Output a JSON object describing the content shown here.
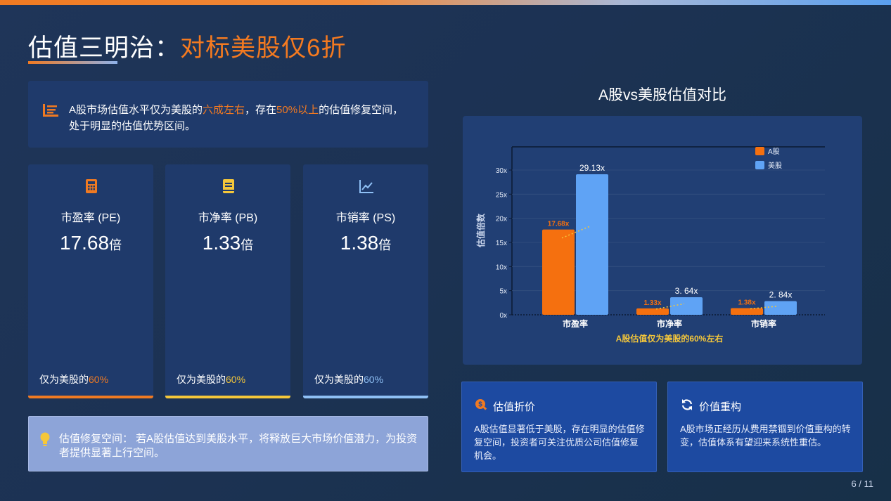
{
  "title": {
    "main": "估值三明治：",
    "accent": "对标美股仅6折"
  },
  "info": {
    "icon": "list-chart-icon",
    "part1": "A股市场估值水平仅为美股的",
    "hl1": "六成左右",
    "part2": "，存在",
    "hl2": "50%以上",
    "part3": "的估值修复空间，处于明显的估值优势区间。"
  },
  "cards": [
    {
      "icon": "calculator-icon",
      "label": "市盈率 (PE)",
      "value": "17.68",
      "unit": "倍",
      "note_prefix": "仅为美股的",
      "note_pct": "60%",
      "accent": "#f07a22"
    },
    {
      "icon": "book-icon",
      "label": "市净率 (PB)",
      "value": "1.33",
      "unit": "倍",
      "note_prefix": "仅为美股的",
      "note_pct": "60%",
      "accent": "#f5c73a"
    },
    {
      "icon": "line-chart-icon",
      "label": "市销率 (PS)",
      "value": "1.38",
      "unit": "倍",
      "note_prefix": "仅为美股的",
      "note_pct": "60%",
      "accent": "#8fc0f5"
    }
  ],
  "tip": {
    "icon": "lightbulb-icon",
    "text": "估值修复空间： 若A股估值达到美股水平，将释放巨大市场价值潜力，为投资者提供显著上行空间。"
  },
  "chart_title": "A股vs美股估值对比",
  "chart_data": {
    "type": "bar",
    "categories": [
      "市盈率",
      "市净率",
      "市销率"
    ],
    "series": [
      {
        "name": "A股",
        "values": [
          17.68,
          1.33,
          1.38
        ],
        "labels": [
          "17.68x",
          "1.33x",
          "1.38x"
        ],
        "color": "#f5700f"
      },
      {
        "name": "美股",
        "values": [
          29.13,
          3.64,
          2.84
        ],
        "labels": [
          "29.13x",
          "3. 64x",
          "2. 84x"
        ],
        "color": "#5fa3f5"
      }
    ],
    "ylabel": "估值倍数",
    "xlabel": "A股估值仅为美股的60%左右",
    "yticks": [
      "0x",
      "5x",
      "10x",
      "15x",
      "20x",
      "25x",
      "30x"
    ],
    "ylim": [
      0,
      30
    ],
    "legend": "top-right",
    "grid": true
  },
  "features": [
    {
      "icon": "search-money-icon",
      "title": "估值折价",
      "text": "A股估值显著低于美股，存在明显的估值修复空间，投资者可关注优质公司估值修复机会。"
    },
    {
      "icon": "refresh-icon",
      "title": "价值重构",
      "text": "A股市场正经历从费用禁锢到价值重构的转变，估值体系有望迎来系统性重估。"
    }
  ],
  "page": "6 / 11"
}
